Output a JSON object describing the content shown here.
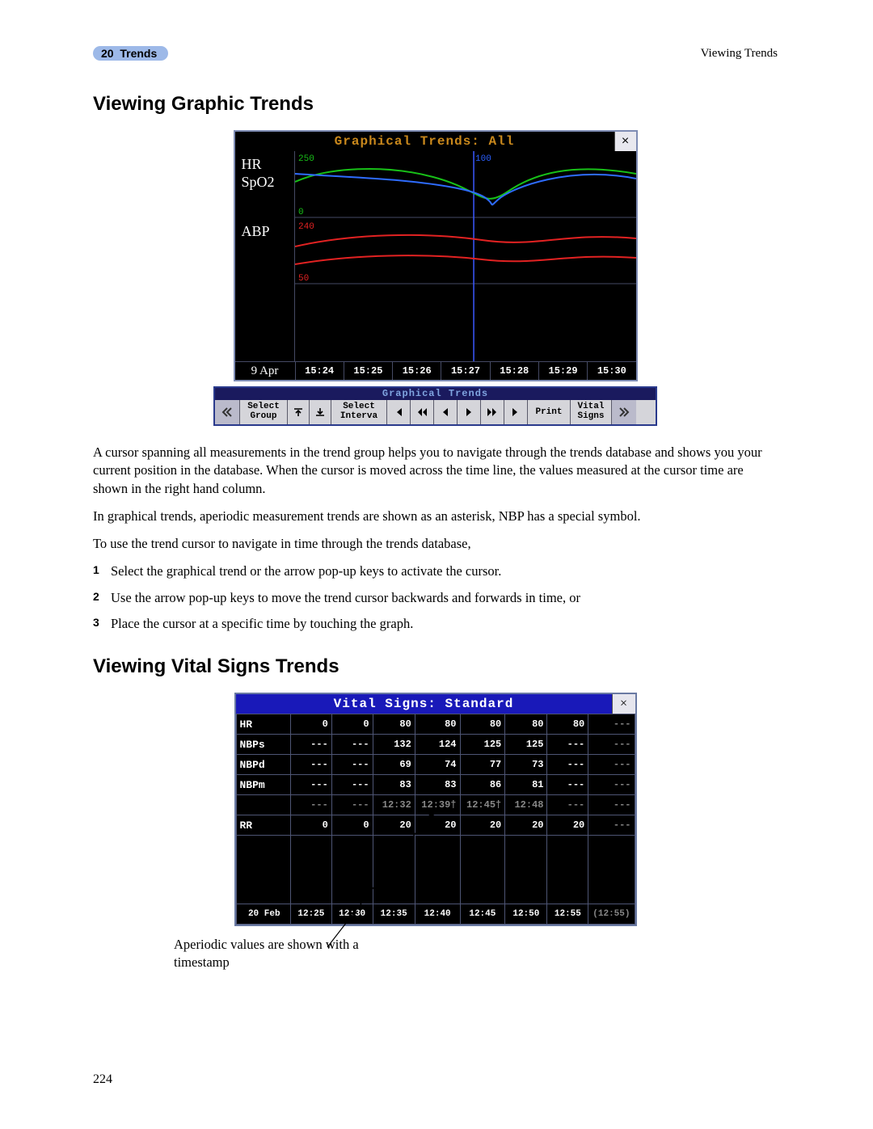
{
  "header": {
    "chapter_num": "20",
    "chapter_title": "Trends",
    "right": "Viewing Trends"
  },
  "section1_title": "Viewing Graphic Trends",
  "gt_window": {
    "title": "Graphical Trends: All",
    "close": "×",
    "labels": {
      "hr": "HR",
      "spo2": "SpO2",
      "abp": "ABP"
    },
    "top_max": "250",
    "top_mid": "100",
    "top_min": "0",
    "mid_max": "240",
    "mid_min": "50",
    "date": "9 Apr",
    "times": [
      "15:24",
      "15:25",
      "15:26",
      "15:27",
      "15:28",
      "15:29",
      "15:30"
    ]
  },
  "toolbar": {
    "title": "Graphical Trends",
    "select_group_l1": "Select",
    "select_group_l2": "Group",
    "select_interval_l1": "Select",
    "select_interval_l2": "Interva",
    "print": "Print",
    "vital_l1": "Vital",
    "vital_l2": "Signs"
  },
  "body": {
    "p1": "A cursor spanning all measurements in the trend group helps you to navigate through the trends database and shows you your current position in the database. When the cursor is moved across the time line, the values measured at the cursor time are shown in the right hand column.",
    "p2": "In graphical trends, aperiodic measurement trends are shown as an asterisk, NBP has a special symbol.",
    "p3": "To use the trend cursor to navigate in time through the trends database,",
    "step1_n": "1",
    "step1": "Select the graphical trend or the arrow pop-up keys to activate the cursor.",
    "step2_n": "2",
    "step2": "Use the arrow pop-up keys to move the trend cursor backwards and forwards in time, or",
    "step3_n": "3",
    "step3": "Place the cursor at a specific time by touching the graph."
  },
  "section2_title": "Viewing Vital Signs Trends",
  "vs_window": {
    "title": "Vital Signs: Standard",
    "close": "×",
    "date": "20 Feb",
    "rows": [
      {
        "label": "HR",
        "vals": [
          "0",
          "0",
          "80",
          "80",
          "80",
          "80",
          "80"
        ],
        "ext": "---"
      },
      {
        "label": "NBPs",
        "vals": [
          "---",
          "---",
          "132",
          "124",
          "125",
          "125",
          "---"
        ],
        "ext": "---"
      },
      {
        "label": "NBPd",
        "vals": [
          "---",
          "---",
          "69",
          "74",
          "77",
          "73",
          "---"
        ],
        "ext": "---"
      },
      {
        "label": "NBPm",
        "vals": [
          "---",
          "---",
          "83",
          "83",
          "86",
          "81",
          "---"
        ],
        "ext": "---"
      },
      {
        "label": "",
        "vals": [
          "---",
          "---",
          "12:32",
          "12:39†",
          "12:45†",
          "12:48",
          "---"
        ],
        "ext": "---",
        "dim": true
      },
      {
        "label": "RR",
        "vals": [
          "0",
          "0",
          "20",
          "20",
          "20",
          "20",
          "20"
        ],
        "ext": "---"
      }
    ],
    "times": [
      "12:25",
      "12:30",
      "12:35",
      "12:40",
      "12:45",
      "12:50",
      "12:55"
    ],
    "time_ext": "(12:55)"
  },
  "annotation": "Aperiodic values are shown with a timestamp",
  "page_number": "224"
}
